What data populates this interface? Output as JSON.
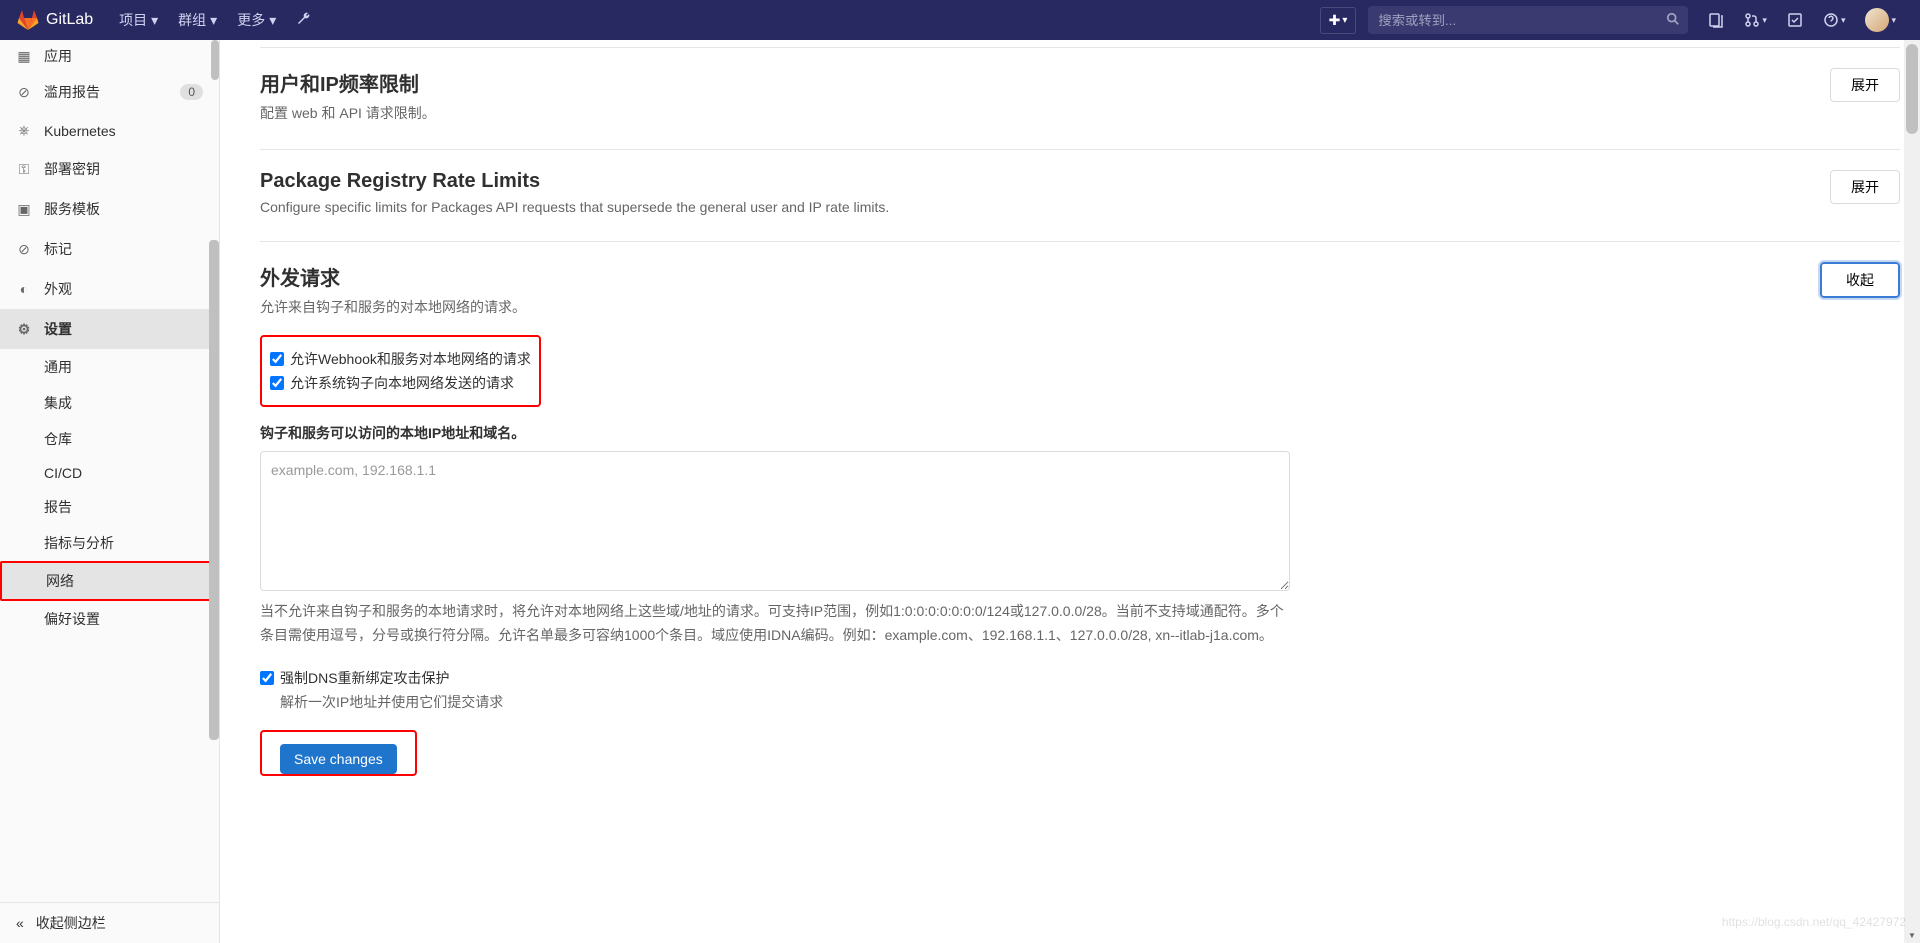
{
  "topnav": {
    "brand": "GitLab",
    "menus": [
      {
        "label": "项目"
      },
      {
        "label": "群组"
      },
      {
        "label": "更多"
      }
    ],
    "search_placeholder": "搜索或转到..."
  },
  "sidebar": {
    "items": [
      {
        "icon": "grid",
        "label": "应用",
        "active": false
      },
      {
        "icon": "shield",
        "label": "滥用报告",
        "badge": "0",
        "active": false
      },
      {
        "icon": "kubernetes",
        "label": "Kubernetes",
        "active": false
      },
      {
        "icon": "key",
        "label": "部署密钥",
        "active": false
      },
      {
        "icon": "template",
        "label": "服务模板",
        "active": false
      },
      {
        "icon": "tag",
        "label": "标记",
        "active": false
      },
      {
        "icon": "appearance",
        "label": "外观",
        "active": false
      },
      {
        "icon": "gear",
        "label": "设置",
        "active": true
      }
    ],
    "subitems": [
      {
        "label": "通用",
        "active": false
      },
      {
        "label": "集成",
        "active": false
      },
      {
        "label": "仓库",
        "active": false
      },
      {
        "label": "CI/CD",
        "active": false
      },
      {
        "label": "报告",
        "active": false
      },
      {
        "label": "指标与分析",
        "active": false
      },
      {
        "label": "网络",
        "active": true
      },
      {
        "label": "偏好设置",
        "active": false
      }
    ],
    "collapse_label": "收起侧边栏"
  },
  "sections": {
    "rate_limit": {
      "title": "用户和IP频率限制",
      "desc": "配置 web 和 API 请求限制。",
      "btn": "展开"
    },
    "package_registry": {
      "title": "Package Registry Rate Limits",
      "desc": "Configure specific limits for Packages API requests that supersede the general user and IP rate limits.",
      "btn": "展开"
    },
    "outbound": {
      "title": "外发请求",
      "desc": "允许来自钩子和服务的对本地网络的请求。",
      "btn": "收起",
      "checkbox1": "允许Webhook和服务对本地网络的请求",
      "checkbox2": "允许系统钩子向本地网络发送的请求",
      "field_label": "钩子和服务可以访问的本地IP地址和域名。",
      "textarea_placeholder": "example.com, 192.168.1.1",
      "help_text": "当不允许来自钩子和服务的本地请求时，将允许对本地网络上这些域/地址的请求。可支持IP范围，例如1:0:0:0:0:0:0:0/124或127.0.0.0/28。当前不支持域通配符。多个条目需使用逗号，分号或换行符分隔。允许名单最多可容纳1000个条目。域应使用IDNA编码。例如：example.com、192.168.1.1、127.0.0.0/28, xn--itlab-j1a.com。",
      "dns_checkbox": "强制DNS重新绑定攻击保护",
      "dns_sub": "解析一次IP地址并使用它们提交请求",
      "save_btn": "Save changes"
    }
  },
  "watermark": "https://blog.csdn.net/qq_42427972"
}
